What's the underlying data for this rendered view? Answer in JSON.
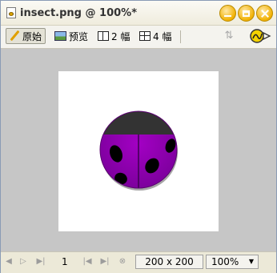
{
  "window": {
    "title": "insect.png @ 100%*"
  },
  "toolbar": {
    "original_label": "原始",
    "preview_label": "预览",
    "two_up_label": "2 幅",
    "four_up_label": "4 幅"
  },
  "status": {
    "frame": "1",
    "dimensions": "200 x 200",
    "zoom": "100%"
  },
  "colors": {
    "beetle_body": "#8a00a8",
    "beetle_head": "#333333",
    "spots": "#000000",
    "canvas_bg": "#c6c6c6",
    "title_buttons": "#f1b000"
  }
}
